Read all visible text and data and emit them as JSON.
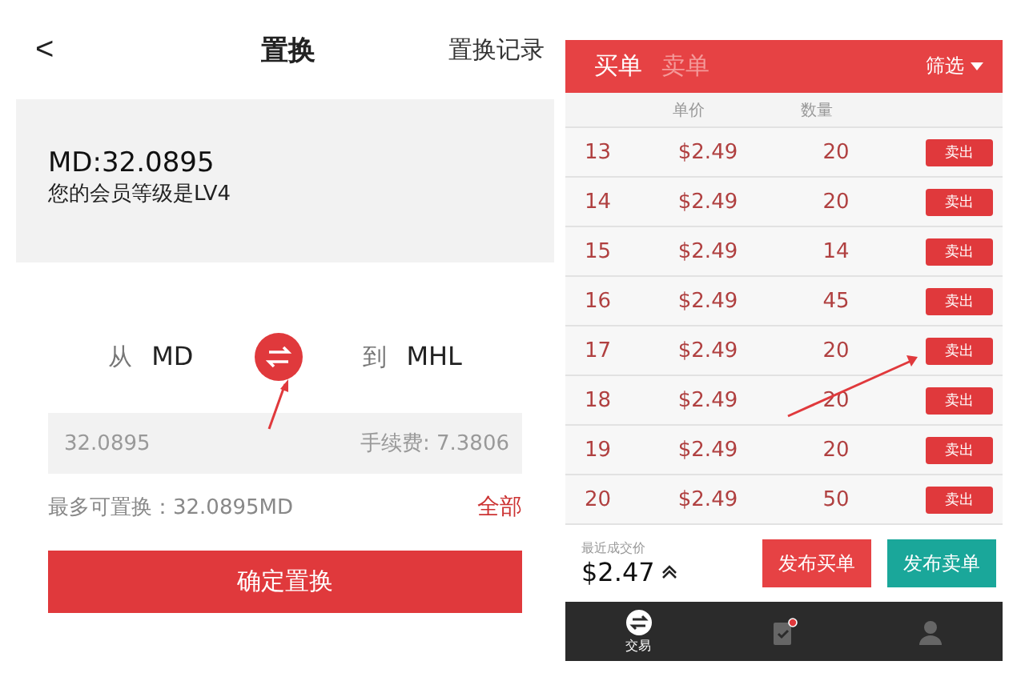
{
  "left": {
    "header": {
      "back": "<",
      "title": "置换",
      "action": "置换记录"
    },
    "account": {
      "balance": "MD:32.0895",
      "level_text": "您的会员等级是LV4"
    },
    "exchange": {
      "from_label": "从",
      "from": "MD",
      "to_label": "到",
      "to": "MHL"
    },
    "amount": {
      "value": "32.0895",
      "fee": "手续费: 7.3806"
    },
    "max": {
      "text": "最多可置换：32.0895MD",
      "all": "全部"
    },
    "confirm": "确定置换"
  },
  "right": {
    "tabs": [
      {
        "label": "买单",
        "selected": true
      },
      {
        "label": "卖单",
        "selected": false
      }
    ],
    "filter": "筛选",
    "columns": [
      "单价",
      "数量"
    ],
    "rows": [
      {
        "index": "13",
        "price": "$2.49",
        "qty": "20",
        "action": "卖出"
      },
      {
        "index": "14",
        "price": "$2.49",
        "qty": "20",
        "action": "卖出"
      },
      {
        "index": "15",
        "price": "$2.49",
        "qty": "14",
        "action": "卖出"
      },
      {
        "index": "16",
        "price": "$2.49",
        "qty": "45",
        "action": "卖出"
      },
      {
        "index": "17",
        "price": "$2.49",
        "qty": "20",
        "action": "卖出"
      },
      {
        "index": "18",
        "price": "$2.49",
        "qty": "20",
        "action": "卖出"
      },
      {
        "index": "19",
        "price": "$2.49",
        "qty": "20",
        "action": "卖出"
      },
      {
        "index": "20",
        "price": "$2.49",
        "qty": "50",
        "action": "卖出"
      }
    ],
    "last_price": {
      "label": "最近成交价",
      "value": "$2.47"
    },
    "buttons": [
      {
        "label": "发布买单",
        "kind": "buy"
      },
      {
        "label": "发布卖单",
        "kind": "sell"
      }
    ],
    "nav": [
      {
        "kind": "trade",
        "label": "交易",
        "selected": true
      },
      {
        "kind": "orders",
        "selected": false,
        "badge": true
      },
      {
        "kind": "profile",
        "selected": false
      }
    ]
  }
}
